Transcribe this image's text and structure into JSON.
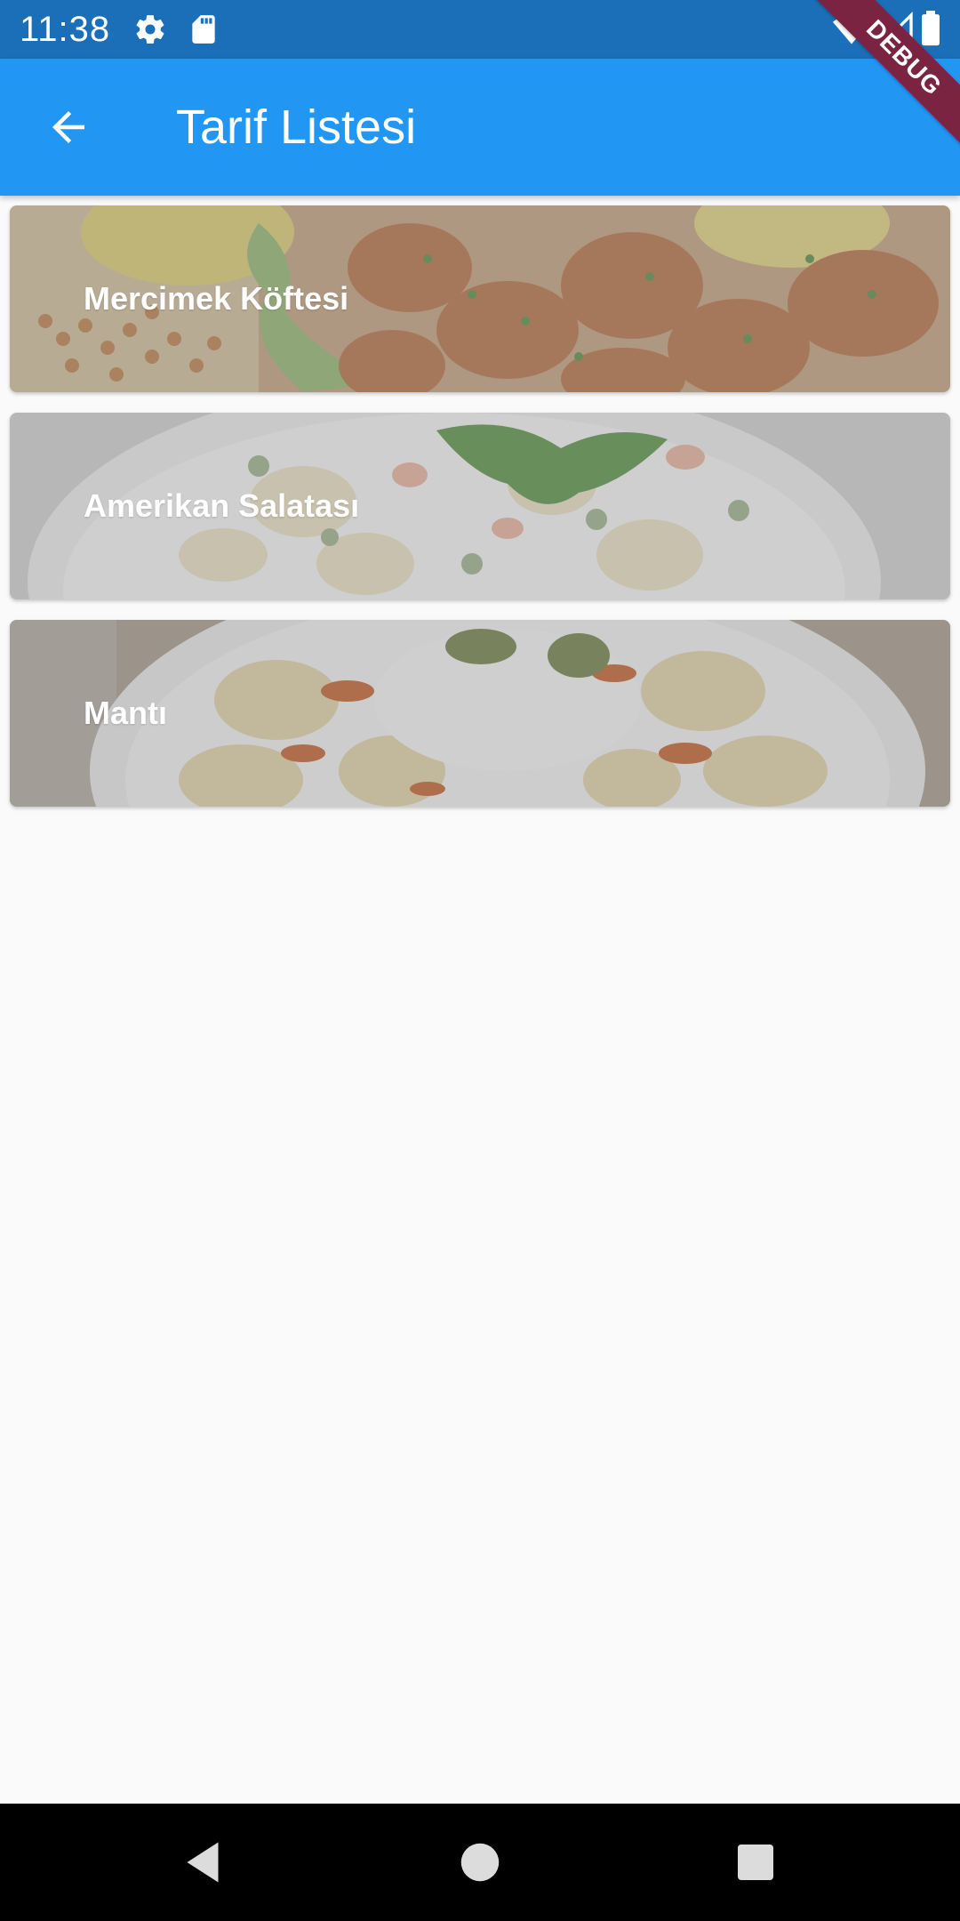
{
  "status_bar": {
    "time": "11:38",
    "background": "#1a6fb8",
    "icons": [
      "gear-icon",
      "sd-card-icon",
      "wifi-icon",
      "cell-signal-icon",
      "battery-icon"
    ]
  },
  "app_bar": {
    "title": "Tarif Listesi",
    "back_icon": "arrow-back-icon",
    "background": "#2196f3"
  },
  "debug_banner": {
    "label": "DEBUG",
    "color": "#7a2442"
  },
  "recipes": [
    {
      "title": "Mercimek Köftesi"
    },
    {
      "title": "Amerikan Salatası"
    },
    {
      "title": "Mantı"
    }
  ],
  "nav_bar": {
    "buttons": [
      "back-triangle-icon",
      "home-circle-icon",
      "recents-square-icon"
    ]
  }
}
